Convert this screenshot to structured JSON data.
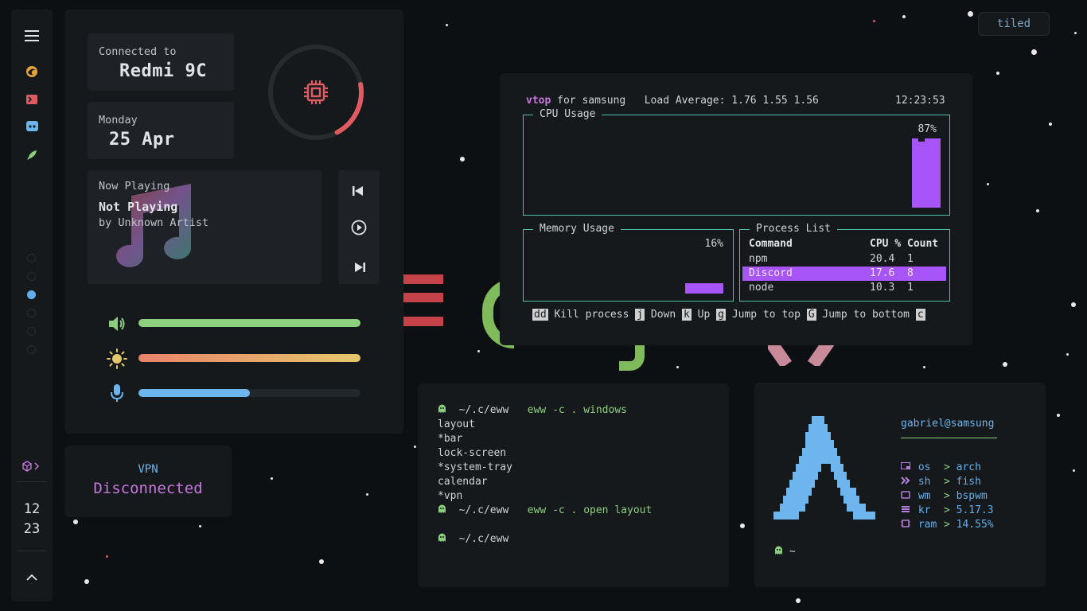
{
  "sidebar": {
    "menu_icon": "hamburger-icon",
    "apps": [
      "firefox-icon",
      "terminal-icon",
      "discord-icon",
      "rocket-icon"
    ],
    "workspaces": [
      false,
      false,
      true,
      false,
      false,
      false
    ],
    "tray_expand_icon": "cube-chevron-icon",
    "clock": {
      "hour": "12",
      "minute": "23"
    },
    "up_icon": "chevron-up-icon"
  },
  "control_center": {
    "network": {
      "caption": "Connected to",
      "name": "Redmi 9C"
    },
    "date": {
      "weekday": "Monday",
      "day": "25 Apr"
    },
    "cpu_ring": {
      "icon": "cpu-icon",
      "value": 0.2
    },
    "media": {
      "caption": "Now Playing",
      "title": "Not Playing",
      "artist": "by Unknown Artist",
      "art_icon": "music-note-icon",
      "prev_icon": "skip-previous-icon",
      "play_icon": "play-circle-icon",
      "next_icon": "skip-next-icon"
    },
    "sliders": [
      {
        "icon": "volume-icon",
        "value": 1.0,
        "color": "#8ccf7e"
      },
      {
        "icon": "brightness-icon",
        "value": 1.0,
        "color": "#e5c76b"
      },
      {
        "icon": "microphone-icon",
        "value": 0.5,
        "color": "#6cb5ed"
      }
    ]
  },
  "vpn": {
    "title": "VPN",
    "status": "Disconnected"
  },
  "layout_label": "tiled",
  "vtop": {
    "app": "vtop",
    "host": "for samsung",
    "load": "Load Average: 1.76 1.55 1.56",
    "time": "12:23:53",
    "cpu": {
      "title": "CPU Usage",
      "percent": "87%",
      "value": 87
    },
    "memory": {
      "title": "Memory Usage",
      "percent": "16%",
      "value": 16
    },
    "processes": {
      "title": "Process List",
      "headers": [
        "Command",
        "CPU %",
        "Count"
      ],
      "rows": [
        {
          "command": "npm",
          "cpu": "20.4",
          "count": "1",
          "selected": false
        },
        {
          "command": "Discord",
          "cpu": "17.6",
          "count": "8",
          "selected": true
        },
        {
          "command": "node",
          "cpu": "10.3",
          "count": "1",
          "selected": false
        }
      ]
    },
    "keys": [
      {
        "key": "dd",
        "label": "Kill process"
      },
      {
        "key": "j",
        "label": "Down"
      },
      {
        "key": "k",
        "label": "Up"
      },
      {
        "key": "g",
        "label": "Jump to top"
      },
      {
        "key": "G",
        "label": "Jump to bottom"
      },
      {
        "key": "c",
        "label": ""
      }
    ]
  },
  "terminal": {
    "prompt_icon": "ghost-icon",
    "dir": "~/.c/eww",
    "cmd1": "eww -c . windows",
    "output": [
      "layout",
      "*bar",
      "lock-screen",
      "*system-tray",
      "calendar",
      "*vpn"
    ],
    "cmd2": "eww -c . open layout",
    "cmd3": ""
  },
  "fetch": {
    "user": "gabriel@samsung",
    "logo_icon": "arch-logo-icon",
    "rows": [
      {
        "icon": "os-icon",
        "key": "os",
        "value": "arch"
      },
      {
        "icon": "shell-icon",
        "key": "sh",
        "value": "fish"
      },
      {
        "icon": "window-icon",
        "key": "wm",
        "value": "bspwm"
      },
      {
        "icon": "kernel-icon",
        "key": "kr",
        "value": "5.17.3"
      },
      {
        "icon": "ram-icon",
        "key": "ram",
        "value": "14.55%"
      }
    ],
    "prompt_icon": "ghost-icon",
    "prompt": "~"
  },
  "colors": {
    "bg": "#0c1013",
    "panel": "#15191c",
    "card": "#1e2226",
    "accent_purple": "#b77ee0",
    "accent_green": "#8ccf7e",
    "accent_blue": "#6cb5ed",
    "accent_red": "#df5b61",
    "border_teal": "#4fc1a9",
    "bar_purple": "#a855f7"
  }
}
